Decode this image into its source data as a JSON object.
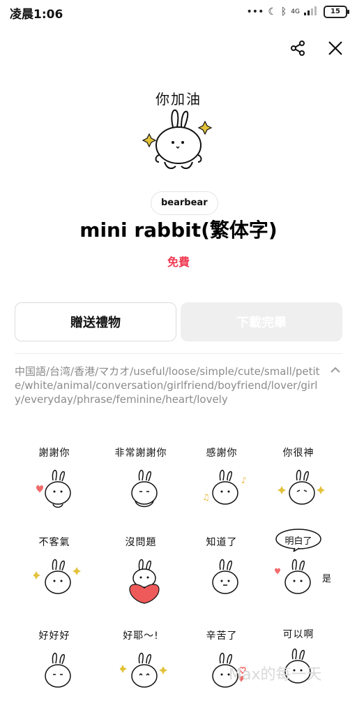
{
  "status": {
    "time": "凌晨1:06",
    "signal_text": "4G",
    "battery": "15"
  },
  "icons": [
    "share-icon",
    "close-icon",
    "chevron-up-icon",
    "bluetooth-icon",
    "moon-icon"
  ],
  "hero": {
    "caption": "你加油"
  },
  "author": "bearbear",
  "title": "mini rabbit(繁体字)",
  "price": "免費",
  "buttons": {
    "gift": "贈送禮物",
    "download": "下載完畢"
  },
  "tags": "中国語/台湾/香港/マカオ/useful/loose/simple/cute/small/petite/white/animal/conversation/girlfriend/boyfriend/lover/girly/everyday/phrase/feminine/heart/lovely",
  "stickers": [
    {
      "caption": "謝謝你"
    },
    {
      "caption": "非常謝謝你"
    },
    {
      "caption": "感謝你"
    },
    {
      "caption": "你很神"
    },
    {
      "caption": "不客氣"
    },
    {
      "caption": "沒問題"
    },
    {
      "caption": "知道了"
    },
    {
      "caption": "明白了"
    },
    {
      "caption": "好好好"
    },
    {
      "caption": "好耶～!"
    },
    {
      "caption": "辛苦了"
    },
    {
      "caption": "可以啊"
    }
  ],
  "sticker_extra": {
    "bubble_text": "明白了",
    "side_text": "是"
  },
  "watermark": "Max的每一天",
  "colors": {
    "price": "#ef3a51",
    "heart": "#f06a6a",
    "note": "#e8b534",
    "sparkle": "#e2c23a",
    "disabled_button": "#efefef"
  }
}
